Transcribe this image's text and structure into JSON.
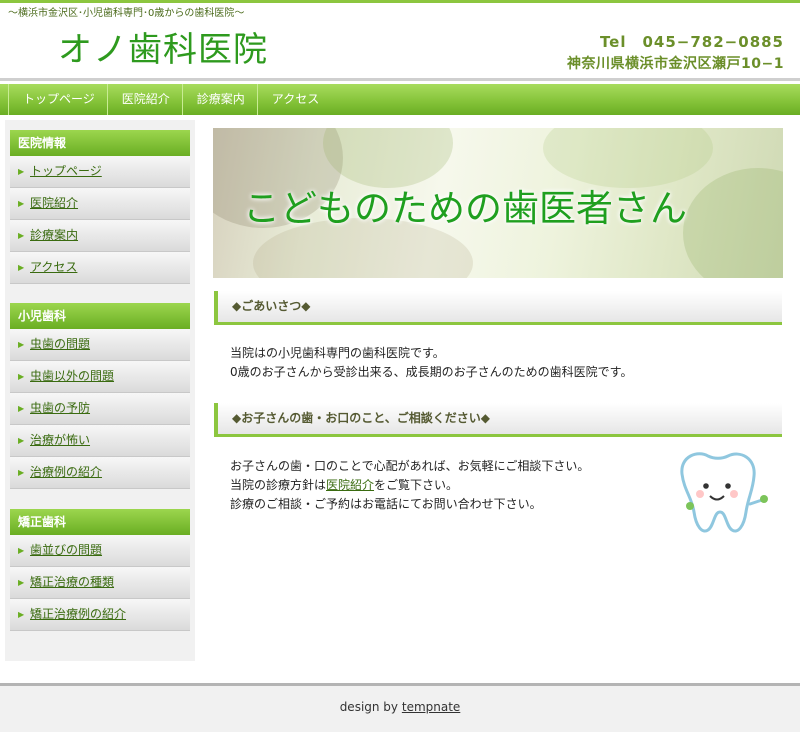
{
  "header": {
    "tagline": "〜横浜市金沢区･小児歯科専門･0歳からの歯科医院〜",
    "logo": "オノ歯科医院",
    "tel": "Tel　045−782−0885",
    "address": "神奈川県横浜市金沢区瀬戸10−1"
  },
  "nav": {
    "items": [
      {
        "label": "トップページ"
      },
      {
        "label": "医院紹介"
      },
      {
        "label": "診療案内"
      },
      {
        "label": "アクセス"
      }
    ]
  },
  "sidebar": {
    "sections": [
      {
        "title": "医院情報",
        "items": [
          {
            "label": "トップページ"
          },
          {
            "label": "医院紹介"
          },
          {
            "label": "診療案内"
          },
          {
            "label": "アクセス"
          }
        ]
      },
      {
        "title": "小児歯科",
        "items": [
          {
            "label": "虫歯の問題"
          },
          {
            "label": "虫歯以外の問題"
          },
          {
            "label": "虫歯の予防"
          },
          {
            "label": "治療が怖い"
          },
          {
            "label": "治療例の紹介"
          }
        ]
      },
      {
        "title": "矯正歯科",
        "items": [
          {
            "label": "歯並びの問題"
          },
          {
            "label": "矯正治療の種類"
          },
          {
            "label": "矯正治療例の紹介"
          }
        ]
      }
    ]
  },
  "hero": {
    "title": "こどものための歯医者さん"
  },
  "main": {
    "greeting": {
      "title": "◆ごあいさつ◆",
      "lines": [
        "当院はの小児歯科専門の歯科医院です。",
        "0歳のお子さんから受診出来る、成長期のお子さんのための歯科医院です。"
      ]
    },
    "consult": {
      "title": "◆お子さんの歯・お口のこと、ご相談ください◆",
      "line1": "お子さんの歯・口のことで心配があれば、お気軽にご相談下さい。",
      "line2_before": "当院の診療方針は",
      "line2_link": "医院紹介",
      "line2_after": "をご覧下さい。",
      "line3": "診療のご相談・ご予約はお電話にてお問い合わせ下さい。"
    }
  },
  "footer": {
    "prefix": "design by",
    "link": "tempnate"
  },
  "colors": {
    "accent": "#8cc63f",
    "logo": "#2e9a1e",
    "nav": "#86c43a"
  }
}
